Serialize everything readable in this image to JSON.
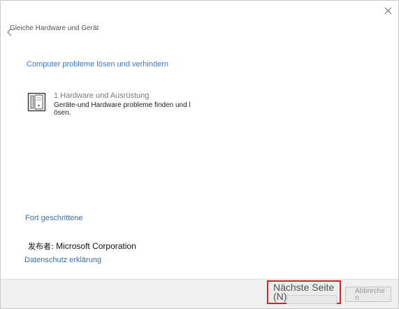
{
  "window": {
    "title": "Gleiche Hardware und Gerät"
  },
  "main": {
    "heading": "Computer probleme lösen und verhindern",
    "option": {
      "title": "1 Hardware und Ausrüstung",
      "description": "Geräte-und Hardware probleme finden und lösen.",
      "icon": "hardware-device-icon"
    }
  },
  "links": {
    "advanced": "Fort geschrittene",
    "privacy": "Datenschutz erklärung"
  },
  "publisher": {
    "label": "发布者:",
    "name": "Microsoft Corporation"
  },
  "footer": {
    "next_label": "Nächste Seite (N)",
    "cancel_label": "Abbrechen"
  },
  "colors": {
    "link": "#3c6ea8",
    "heading": "#3c78c8",
    "highlight": "#d0232a",
    "footer_bg": "#f0f0f0"
  }
}
